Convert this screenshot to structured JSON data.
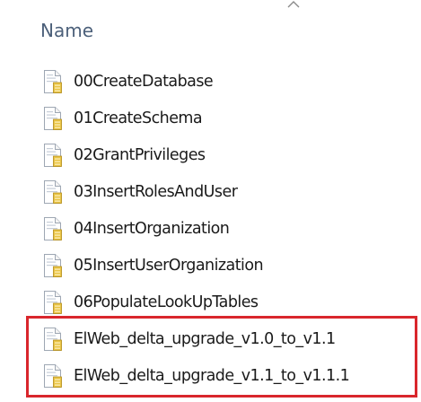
{
  "header": {
    "name_label": "Name",
    "sort_icon": "chevron-up-icon"
  },
  "files": [
    {
      "name": "00CreateDatabase",
      "icon": "sql-script-file-icon"
    },
    {
      "name": "01CreateSchema",
      "icon": "sql-script-file-icon"
    },
    {
      "name": "02GrantPrivileges",
      "icon": "sql-script-file-icon"
    },
    {
      "name": "03InsertRolesAndUser",
      "icon": "sql-script-file-icon"
    },
    {
      "name": "04InsertOrganization",
      "icon": "sql-script-file-icon"
    },
    {
      "name": "05InsertUserOrganization",
      "icon": "sql-script-file-icon"
    },
    {
      "name": "06PopulateLookUpTables",
      "icon": "sql-script-file-icon"
    },
    {
      "name": "ElWeb_delta_upgrade_v1.0_to_v1.1",
      "icon": "sql-script-file-icon"
    },
    {
      "name": "ElWeb_delta_upgrade_v1.1_to_v1.1.1",
      "icon": "sql-script-file-icon"
    }
  ],
  "colors": {
    "header_text": "#4c607a",
    "file_text": "#1a1a1a",
    "highlight_border": "#d9262c",
    "icon_paper": "#ffffff",
    "icon_fold": "#e6c65a",
    "icon_lock": "#e3b820"
  }
}
